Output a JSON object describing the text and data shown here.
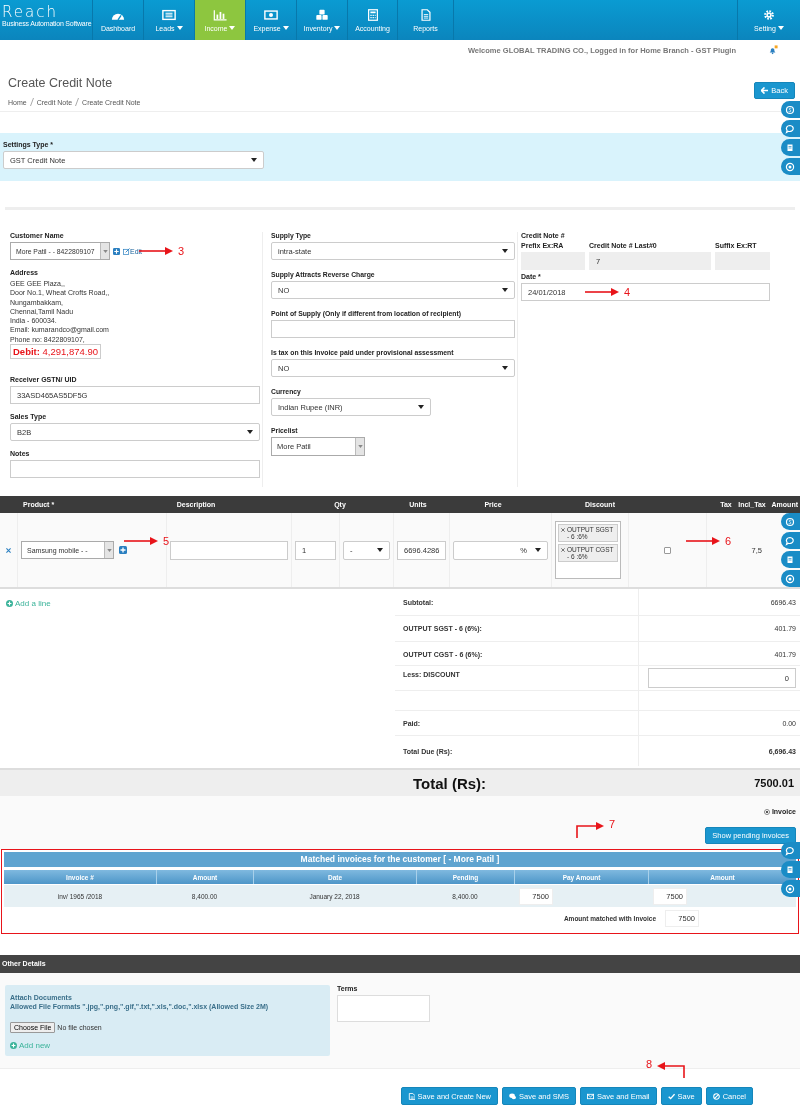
{
  "nav": {
    "logo_title": "Reach",
    "logo_subtitle": "Business Automation Software",
    "items": [
      {
        "label": "Dashboard",
        "dropdown": false,
        "selected": false
      },
      {
        "label": "Leads",
        "dropdown": true,
        "selected": false
      },
      {
        "label": "Income",
        "dropdown": true,
        "selected": true
      },
      {
        "label": "Expense",
        "dropdown": true,
        "selected": false
      },
      {
        "label": "Inventory",
        "dropdown": true,
        "selected": false
      },
      {
        "label": "Accounting",
        "dropdown": false,
        "selected": false
      },
      {
        "label": "Reports",
        "dropdown": false,
        "selected": false
      }
    ],
    "setting": {
      "label": "Setting",
      "dropdown": true
    }
  },
  "welcome": "Welcome GLOBAL TRADING CO., Logged in for Home Branch - GST Plugin",
  "page": {
    "title": "Create Credit Note",
    "breadcrumb": [
      "Home",
      "Credit Note",
      "Create Credit Note"
    ],
    "back": "Back"
  },
  "settings_type": {
    "label": "Settings Type *",
    "value": "GST Credit Note"
  },
  "left_fields": [
    {
      "label": "Customer Name",
      "kind": "combo",
      "value": "More Patil - - 8422809107",
      "edit": "Edit"
    },
    {
      "label": "Address",
      "kind": "address",
      "lines": [
        "GEE GEE Plaza,,",
        "Door No.1, Wheat Crofts Road,,",
        "Nungambakkam,",
        "Chennai,Tamil Nadu",
        "India - 600034.",
        "Email: kumarandco@gmail.com",
        "Phone no: 8422809107,"
      ],
      "debit_label": "Debit:",
      "debit_value": "4,291,874.90"
    },
    {
      "label": "Receiver GSTN/ UID",
      "kind": "text",
      "value": "33ASD465AS5DF5G"
    },
    {
      "label": "Sales Type",
      "kind": "select",
      "value": "B2B"
    },
    {
      "label": "Notes",
      "kind": "text"
    }
  ],
  "middle_fields": [
    {
      "label": "Supply Type",
      "kind": "select",
      "value": "intra-state"
    },
    {
      "label": "Supply Attracts Reverse Charge",
      "kind": "select",
      "value": "NO"
    },
    {
      "label": "Point of Supply (Only if different from location of recipient)",
      "kind": "text"
    },
    {
      "label": "Is tax on this Invoice paid under provisional assessment",
      "kind": "select",
      "value": "NO"
    },
    {
      "label": "Currency",
      "kind": "select",
      "value": "Indian Rupee (INR)"
    },
    {
      "label": "Pricelist",
      "kind": "combo",
      "value": "More Patil"
    }
  ],
  "credit_note": {
    "label": "Credit Note #",
    "prefix_label": "Prefix Ex:RA",
    "number_label": "Credit Note # Last#0",
    "number": "7",
    "suffix_label": "Suffix Ex:RT",
    "date_label": "Date *",
    "date": "24/01/2018"
  },
  "product_columns": [
    "Product *",
    "Description",
    "Qty",
    "Units",
    "Price",
    "Discount",
    "Tax",
    "Incl_Tax",
    "Amount"
  ],
  "product_rows": [
    {
      "product": "Samsung mobile - -",
      "qty": "1",
      "unit": "-",
      "rate": "6696.4286",
      "discount_type": "%",
      "taxes": [
        "OUTPUT SGST - 6 :6%",
        "OUTPUT CGST - 6 :6%"
      ],
      "incl_tax": false,
      "amount": "7,5"
    }
  ],
  "add_line": "Add a line",
  "totals": [
    {
      "kind": "value",
      "label": "Subtotal:",
      "value": "6696.43"
    },
    {
      "kind": "value",
      "label": "OUTPUT SGST - 6 (6%):",
      "value": "401.79"
    },
    {
      "kind": "value",
      "label": "OUTPUT CGST - 6 (6%):",
      "value": "401.79"
    },
    {
      "kind": "input",
      "label": "Less: DISCOUNT",
      "value": "0"
    },
    {
      "kind": "spacer"
    },
    {
      "kind": "value",
      "label": "Paid:",
      "value": "0.00"
    },
    {
      "kind": "total",
      "label": "Total Due (Rs):",
      "value": "6,696.43"
    }
  ],
  "grand_total": {
    "label": "Total (Rs):",
    "value": "7500.01"
  },
  "match_type": {
    "label": "Invoice",
    "selected": true
  },
  "show_pending": "Show pending invoices",
  "matched": {
    "title": "Matched invoices for the customer [ - More Patil ]",
    "columns": [
      "Invoice #",
      "Amount",
      "Date",
      "Pending",
      "Pay Amount",
      "Amount"
    ],
    "rows": [
      {
        "invoice": "inv/ 1965 /2018",
        "amount": "8,400.00",
        "date": "January 22, 2018",
        "pending": "8,400.00",
        "pay_amount": "7500",
        "matched_amount": "7500"
      }
    ],
    "total_label": "Amount matched with Invoice",
    "total": "7500"
  },
  "other_details": {
    "title": "Other Details",
    "attach_title": "Attach Documents",
    "formats": "Allowed File Formats \".jpg,\".png,\".gif,\".txt,\".xls,\".doc,\".xlsx (Allowed Size 2M)",
    "choose": "Choose File",
    "no_file": "No file chosen",
    "add_new": "Add new",
    "terms_label": "Terms"
  },
  "actions": [
    "Save and Create New",
    "Save and SMS",
    "Save and Email",
    "Save",
    "Cancel"
  ],
  "annotations": [
    {
      "label": "3",
      "kind": "right"
    },
    {
      "label": "4",
      "kind": "right"
    },
    {
      "label": "5",
      "kind": "right"
    },
    {
      "label": "6",
      "kind": "right"
    },
    {
      "label": "7",
      "kind": "bent-right"
    },
    {
      "label": "8",
      "kind": "bent-left"
    }
  ]
}
